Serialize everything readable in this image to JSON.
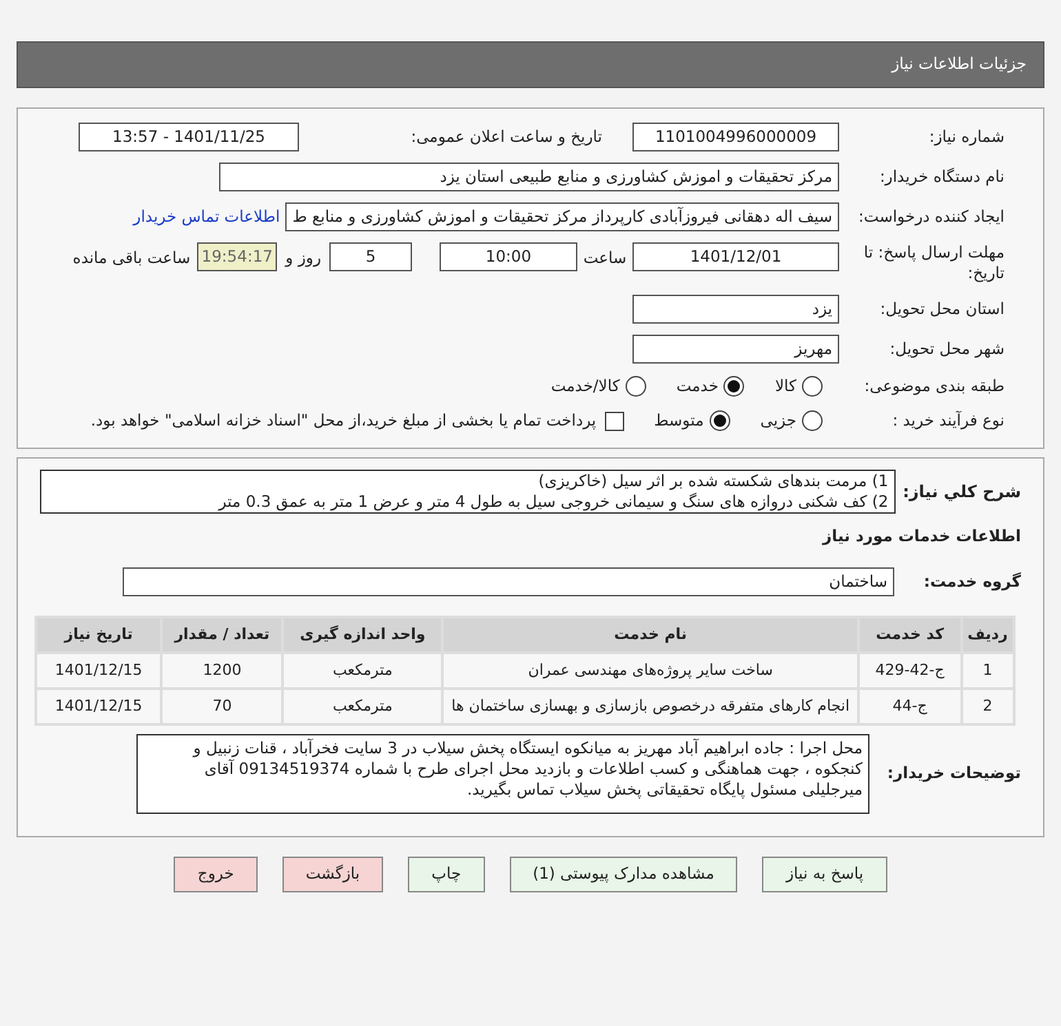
{
  "header": {
    "title": "جزئیات اطلاعات نیاز"
  },
  "need_number": {
    "label": "شماره نیاز:",
    "value": "1101004996000009"
  },
  "announce": {
    "label": "تاریخ و ساعت اعلان عمومی:",
    "value": "1401/11/25 - 13:57"
  },
  "buyer_org": {
    "label": "نام دستگاه خریدار:",
    "value": "مرکز تحقیقات و اموزش کشاورزی و منابع طبیعی استان یزد"
  },
  "requester": {
    "label": "ایجاد کننده درخواست:",
    "value": "سیف اله دهقانی فیروزآبادی کارپرداز مرکز تحقیقات و اموزش کشاورزی و منابع ط",
    "link": "اطلاعات تماس خریدار"
  },
  "deadline": {
    "label": "مهلت ارسال پاسخ: تا تاریخ:",
    "date": "1401/12/01",
    "time_label": "ساعت",
    "time": "10:00",
    "days": "5",
    "days_label": "روز و",
    "remaining": "19:54:17",
    "remaining_label": "ساعت باقی مانده"
  },
  "province": {
    "label": "استان محل تحویل:",
    "value": "یزد"
  },
  "city": {
    "label": "شهر محل تحویل:",
    "value": "مهریز"
  },
  "category": {
    "label": "طبقه بندی موضوعی:",
    "options": [
      {
        "label": "کالا",
        "selected": false
      },
      {
        "label": "خدمت",
        "selected": true
      },
      {
        "label": "کالا/خدمت",
        "selected": false
      }
    ]
  },
  "process": {
    "label": "نوع فرآیند خرید :",
    "options": [
      {
        "label": "جزیی",
        "selected": false
      },
      {
        "label": "متوسط",
        "selected": true
      }
    ],
    "checkbox": {
      "checked": false,
      "label": "پرداخت تمام یا بخشی از مبلغ خرید،از محل \"اسناد خزانه اسلامی\" خواهد بود."
    }
  },
  "description": {
    "label": "شرح کلي نياز:",
    "lines": [
      "1) مرمت بندهای شکسته شده بر اثر سیل (خاکریزی)",
      "2) کف شکنی دروازه های سنگ و سیمانی خروجی سیل به طول 4 متر و عرض 1 متر به عمق 0.3 متر"
    ]
  },
  "services_title": "اطلاعات خدمات مورد نیاز",
  "service_group": {
    "label": "گروه خدمت:",
    "value": "ساختمان"
  },
  "table": {
    "columns": [
      "ردیف",
      "کد خدمت",
      "نام خدمت",
      "واحد اندازه گیری",
      "تعداد / مقدار",
      "تاریخ نیاز"
    ],
    "rows": [
      [
        "1",
        "ج-42-429",
        "ساخت سایر پروژه‌های مهندسی عمران",
        "مترمکعب",
        "1200",
        "1401/12/15"
      ],
      [
        "2",
        "ج-44",
        "انجام کارهای متفرقه درخصوص بازسازی و بهسازی ساختمان ها",
        "مترمکعب",
        "70",
        "1401/12/15"
      ]
    ]
  },
  "buyer_notes": {
    "label": "توضیحات خریدار:",
    "text": "محل اجرا : جاده ابراهیم آباد مهریز به میانکوه ایستگاه پخش سیلاب در  3 سایت فخرآباد ، قنات زنبیل و کنجکوه ، جهت هماهنگی و کسب اطلاعات و بازدید محل اجرای طرح با شماره 09134519374 آقای میرجلیلی مسئول پایگاه تحقیقاتی پخش سیلاب تماس بگیرید."
  },
  "buttons": [
    {
      "label": "پاسخ به نیاز",
      "kind": "normal"
    },
    {
      "label": "مشاهده مدارک پیوستی (1)",
      "kind": "normal"
    },
    {
      "label": "چاپ",
      "kind": "normal"
    },
    {
      "label": "بازگشت",
      "kind": "danger"
    },
    {
      "label": "خروج",
      "kind": "danger"
    }
  ]
}
